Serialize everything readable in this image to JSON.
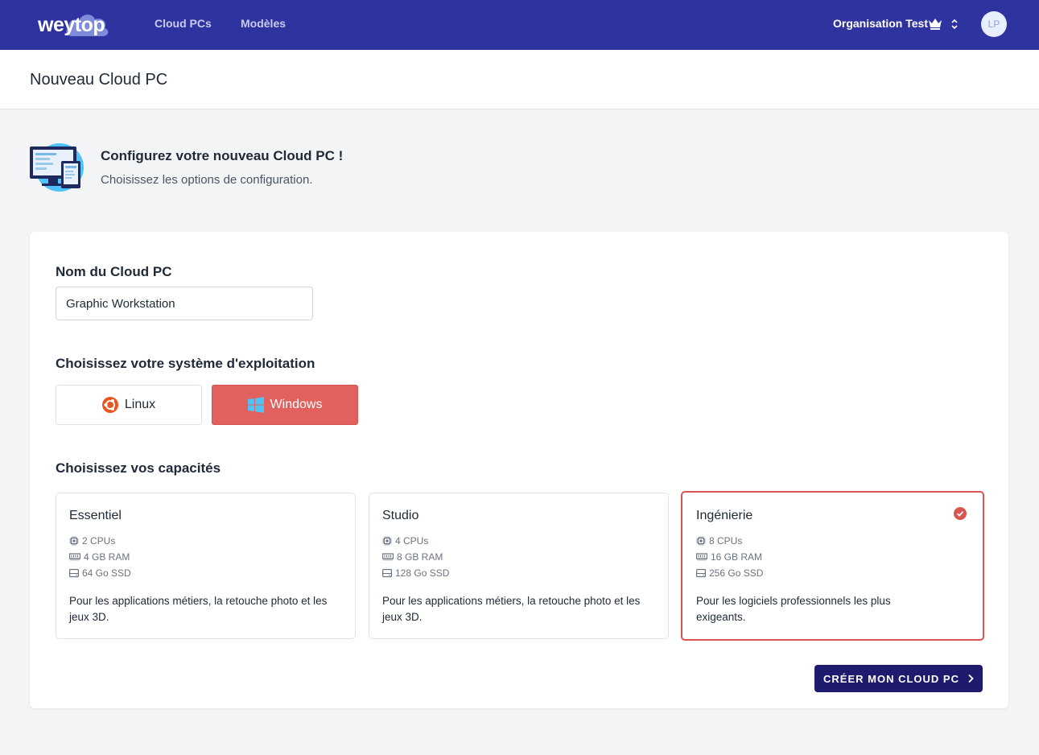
{
  "nav": {
    "logo_text": "weytop",
    "links": [
      "Cloud PCs",
      "Modèles"
    ],
    "organization": "Organisation Test",
    "avatar_initials": "LP"
  },
  "header": {
    "title": "Nouveau Cloud PC"
  },
  "intro": {
    "title": "Configurez votre nouveau Cloud PC !",
    "subtitle": "Choisissez les options de configuration."
  },
  "form": {
    "name_label": "Nom du Cloud PC",
    "name_value": "Graphic Workstation",
    "os_label": "Choisissez votre système d'exploitation",
    "os_options": [
      {
        "label": "Linux",
        "icon": "ubuntu-icon",
        "selected": false
      },
      {
        "label": "Windows",
        "icon": "windows-icon",
        "selected": true
      }
    ],
    "capacity_label": "Choisissez vos capacités",
    "tiers": [
      {
        "name": "Essentiel",
        "cpu": "2 CPUs",
        "ram": "4 GB RAM",
        "ssd": "64 Go SSD",
        "description": "Pour les applications métiers, la retouche photo et les jeux 3D.",
        "selected": false
      },
      {
        "name": "Studio",
        "cpu": "4 CPUs",
        "ram": "8 GB RAM",
        "ssd": "128 Go SSD",
        "description": "Pour les applications métiers, la retouche photo et les jeux 3D.",
        "selected": false
      },
      {
        "name": "Ingénierie",
        "cpu": "8 CPUs",
        "ram": "16 GB RAM",
        "ssd": "256 Go SSD",
        "description": "Pour les logiciels professionnels les plus exigeants.",
        "selected": true
      }
    ],
    "submit_label": "CRÉER MON CLOUD PC"
  },
  "colors": {
    "nav_bg": "#2f33a0",
    "accent_red": "#e0615d",
    "cta_bg": "#1e1b6e"
  }
}
